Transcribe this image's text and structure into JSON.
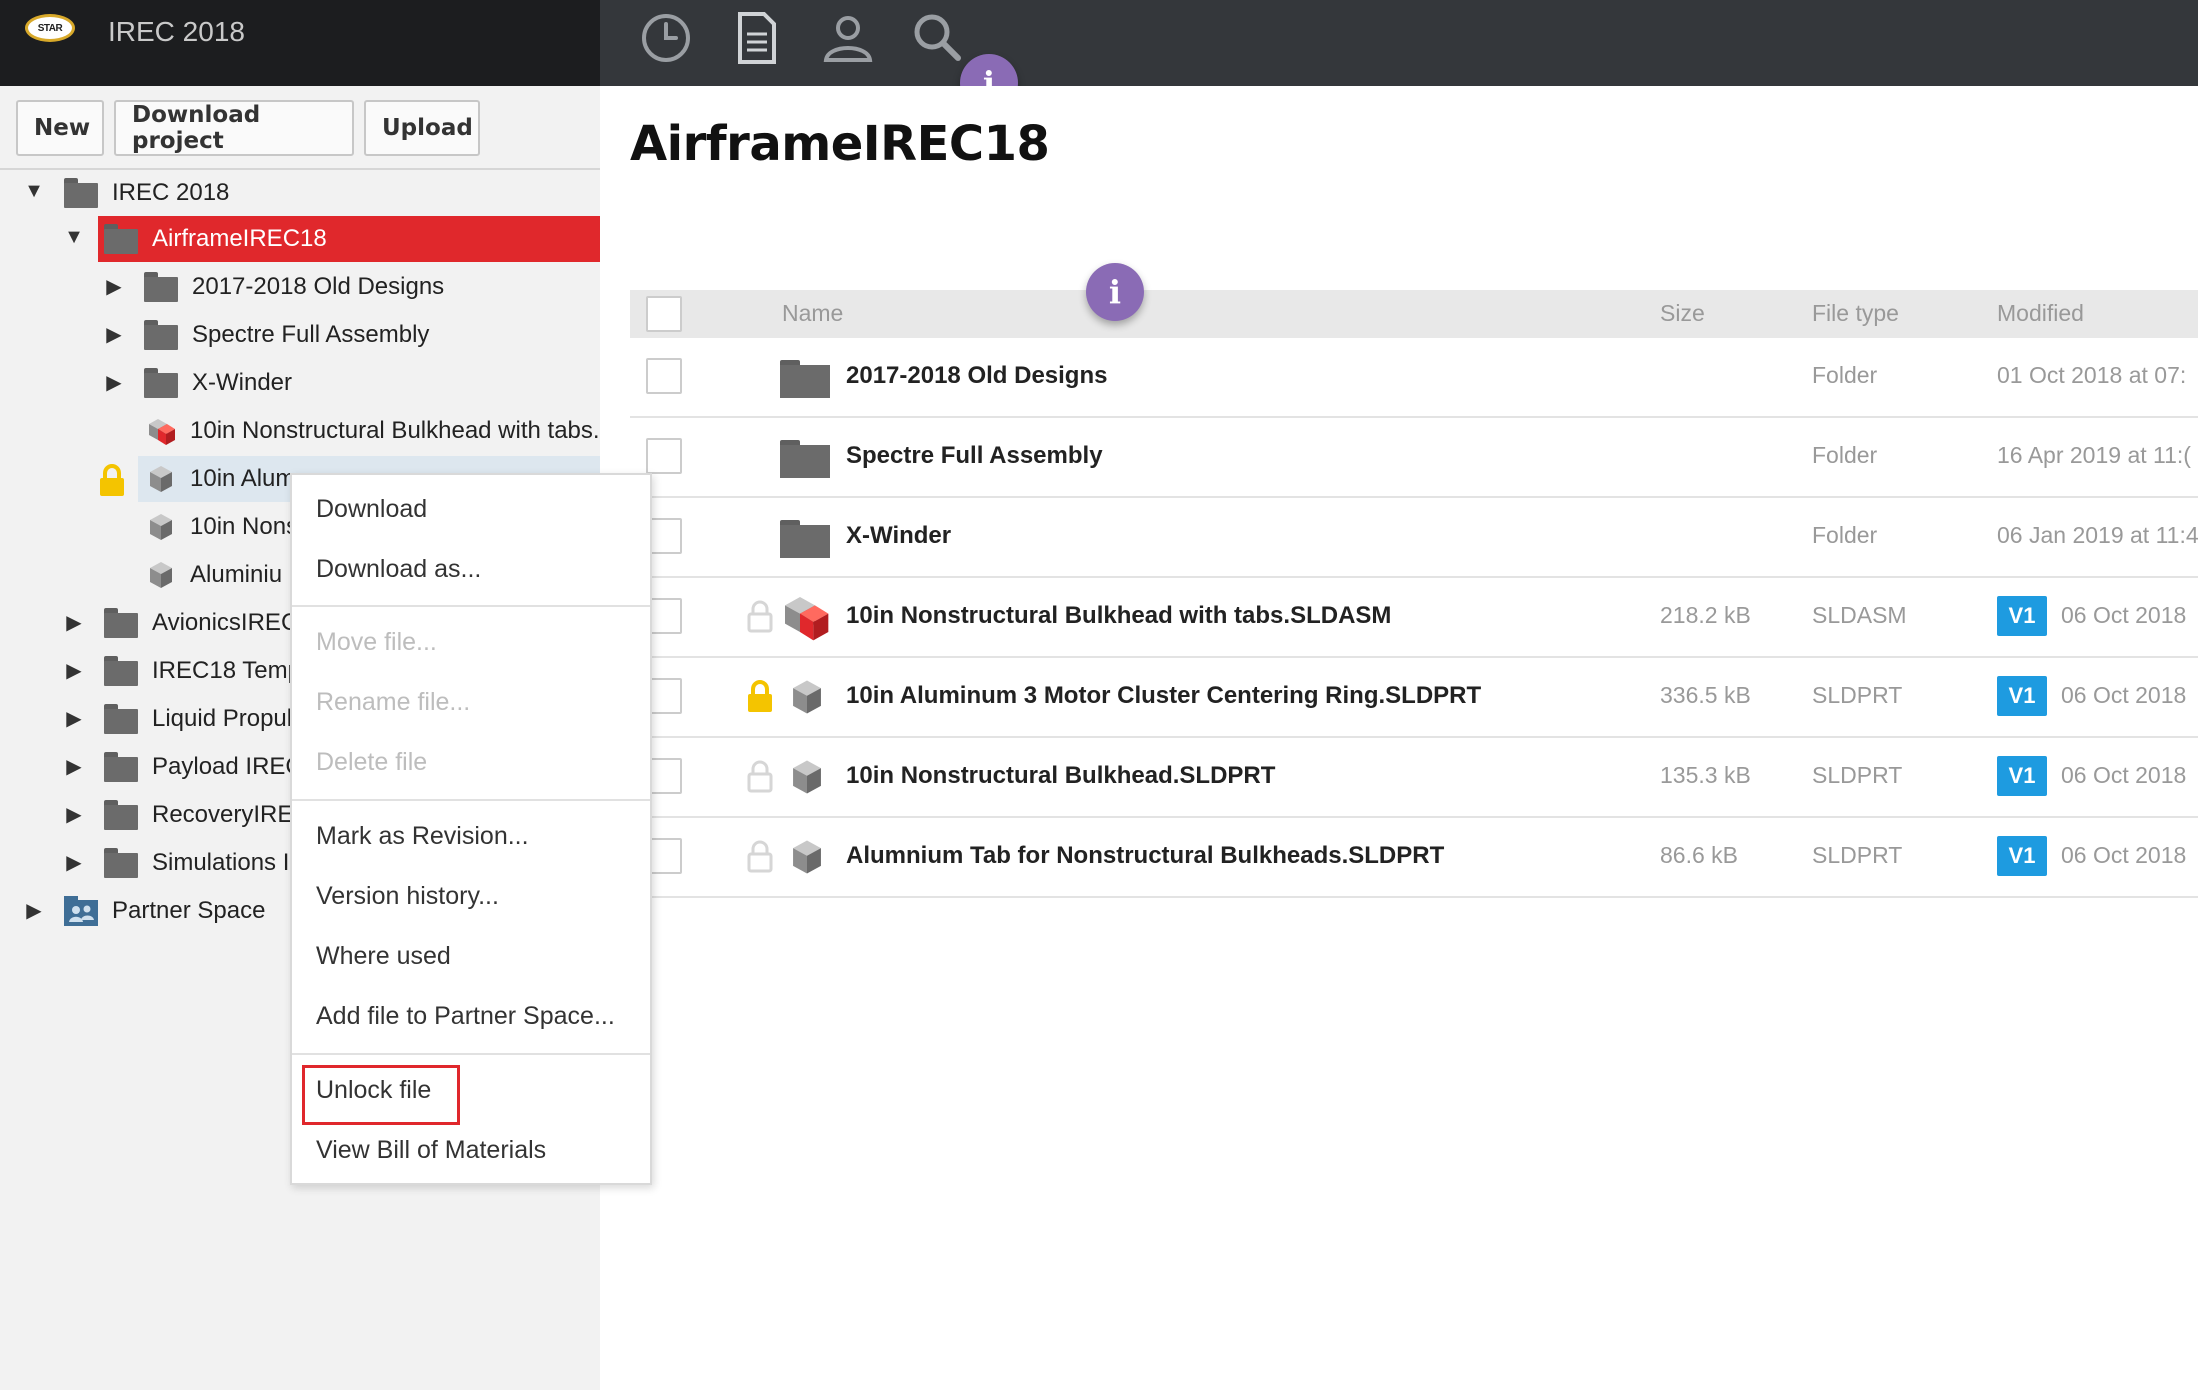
{
  "app": {
    "title": "IREC 2018",
    "logo_text": "STAR"
  },
  "toolbar_icons": [
    "clock-icon",
    "document-icon",
    "user-icon",
    "search-icon"
  ],
  "sidebar": {
    "buttons": {
      "new": "New",
      "download_project": "Download project",
      "upload": "Upload"
    },
    "tree": {
      "root": "IREC 2018",
      "selected": "AirframeIREC18",
      "children": [
        "2017-2018 Old Designs",
        "Spectre Full Assembly",
        "X-Winder"
      ],
      "files": [
        "10in Nonstructural Bulkhead with tabs.",
        "10in Alum",
        "10in Nons",
        "Aluminiu"
      ],
      "siblings": [
        "AvionicsIREC",
        "IREC18 Temp",
        "Liquid Propul",
        "Payload IREC",
        "RecoveryIRE",
        "Simulations I"
      ],
      "partner_space": "Partner Space"
    }
  },
  "main": {
    "title": "AirframeIREC18",
    "info_glyph": "i",
    "columns": {
      "name": "Name",
      "size": "Size",
      "file_type": "File type",
      "modified": "Modified"
    },
    "rows": [
      {
        "name": "2017-2018 Old Designs",
        "size": "",
        "type": "Folder",
        "modified": "01 Oct 2018 at 07:",
        "kind": "folder"
      },
      {
        "name": "Spectre Full Assembly",
        "size": "",
        "type": "Folder",
        "modified": "16 Apr 2019 at 11:(",
        "kind": "folder"
      },
      {
        "name": "X-Winder",
        "size": "",
        "type": "Folder",
        "modified": "06 Jan 2019 at 11:4",
        "kind": "folder"
      },
      {
        "name": "10in Nonstructural Bulkhead with tabs.SLDASM",
        "size": "218.2 kB",
        "type": "SLDASM",
        "version": "V1",
        "modified": "06 Oct 2018",
        "kind": "assembly",
        "locked": false
      },
      {
        "name": "10in Aluminum 3 Motor Cluster Centering Ring.SLDPRT",
        "size": "336.5 kB",
        "type": "SLDPRT",
        "version": "V1",
        "modified": "06 Oct 2018",
        "kind": "part",
        "locked": true
      },
      {
        "name": "10in Nonstructural Bulkhead.SLDPRT",
        "size": "135.3 kB",
        "type": "SLDPRT",
        "version": "V1",
        "modified": "06 Oct 2018",
        "kind": "part",
        "locked": false
      },
      {
        "name": "Alumnium Tab for Nonstructural Bulkheads.SLDPRT",
        "size": "86.6 kB",
        "type": "SLDPRT",
        "version": "V1",
        "modified": "06 Oct 2018",
        "kind": "part",
        "locked": false
      }
    ]
  },
  "context_menu": {
    "download": "Download",
    "download_as": "Download as...",
    "move_file": "Move file...",
    "rename_file": "Rename file...",
    "delete_file": "Delete file",
    "mark_revision": "Mark as Revision...",
    "version_history": "Version history...",
    "where_used": "Where used",
    "add_partner": "Add file to Partner Space...",
    "unlock_file": "Unlock file",
    "view_bom": "View Bill of Materials"
  },
  "colors": {
    "accent_red": "#e0282c",
    "version_blue": "#1e9be0",
    "lock_yellow": "#f4c400",
    "info_purple": "#8a6bb5",
    "header_dark": "#34373b"
  }
}
